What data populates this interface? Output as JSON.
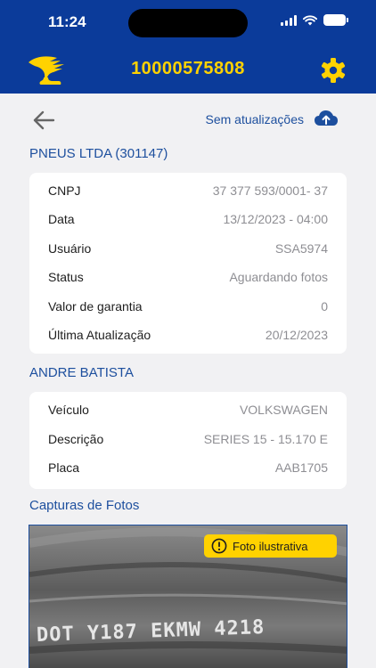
{
  "status_bar": {
    "time": "11:24"
  },
  "header": {
    "order_number": "10000575808"
  },
  "toolbar": {
    "sync_label": "Sem atualizações"
  },
  "customer": {
    "title": "PNEUS LTDA (301147)",
    "rows": [
      {
        "label": "CNPJ",
        "value": "37 377 593/0001- 37"
      },
      {
        "label": "Data",
        "value": "13/12/2023 - 04:00"
      },
      {
        "label": "Usuário",
        "value": "SSA5974"
      },
      {
        "label": "Status",
        "value": "Aguardando fotos"
      },
      {
        "label": "Valor de garantia",
        "value": "0"
      },
      {
        "label": "Última Atualização",
        "value": "20/12/2023"
      }
    ]
  },
  "vehicle": {
    "title": "ANDRE BATISTA",
    "rows": [
      {
        "label": "Veículo",
        "value": "VOLKSWAGEN"
      },
      {
        "label": "Descrição",
        "value": "SERIES 15 - 15.170 E"
      },
      {
        "label": "Placa",
        "value": "AAB1705"
      }
    ]
  },
  "photos": {
    "title": "Capturas de Fotos",
    "badge_label": "Foto ilustrativa",
    "tire_marking": "DOT Y187 EKMW 4218"
  },
  "colors": {
    "header_bg": "#0b3b9a",
    "accent_yellow": "#ffd200",
    "link_blue": "#1d4f9e"
  }
}
